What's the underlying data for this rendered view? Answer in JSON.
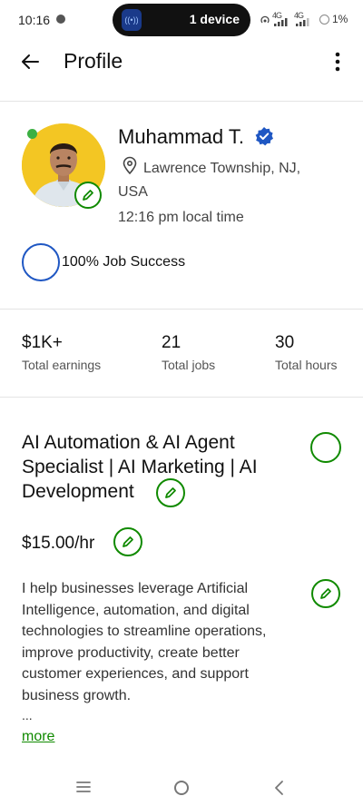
{
  "status_bar": {
    "time": "10:16",
    "pill_label": "1 device",
    "network_1": "4G",
    "network_2": "4G",
    "battery": "1%"
  },
  "header": {
    "title": "Profile"
  },
  "profile": {
    "name": "Muhammad T.",
    "location": "Lawrence Township, NJ, USA",
    "local_time": "12:16 pm local time",
    "job_success": "100% Job Success",
    "online_color": "#3cb043",
    "verified_color": "#1f57c3"
  },
  "stats": [
    {
      "value": "$1K+",
      "label": "Total earnings"
    },
    {
      "value": "21",
      "label": "Total jobs"
    },
    {
      "value": "30",
      "label": "Total hours"
    }
  ],
  "listing": {
    "title": "AI Automation & AI Agent Specialist | AI Marketing | AI Development",
    "rate": "$15.00/hr",
    "bio": "I help businesses leverage Artificial Intelligence, automation, and digital technologies to streamline operations, improve productivity, create better customer experiences, and support business growth.",
    "ellipsis": "...",
    "more_label": "more"
  },
  "theme": {
    "accent": "#108a00",
    "divider": "#e4e4e4"
  },
  "icons": {
    "back": "arrow-left-icon",
    "menu": "kebab-menu-icon",
    "edit": "pencil-icon",
    "location": "map-pin-icon",
    "verified": "verified-badge-icon"
  }
}
